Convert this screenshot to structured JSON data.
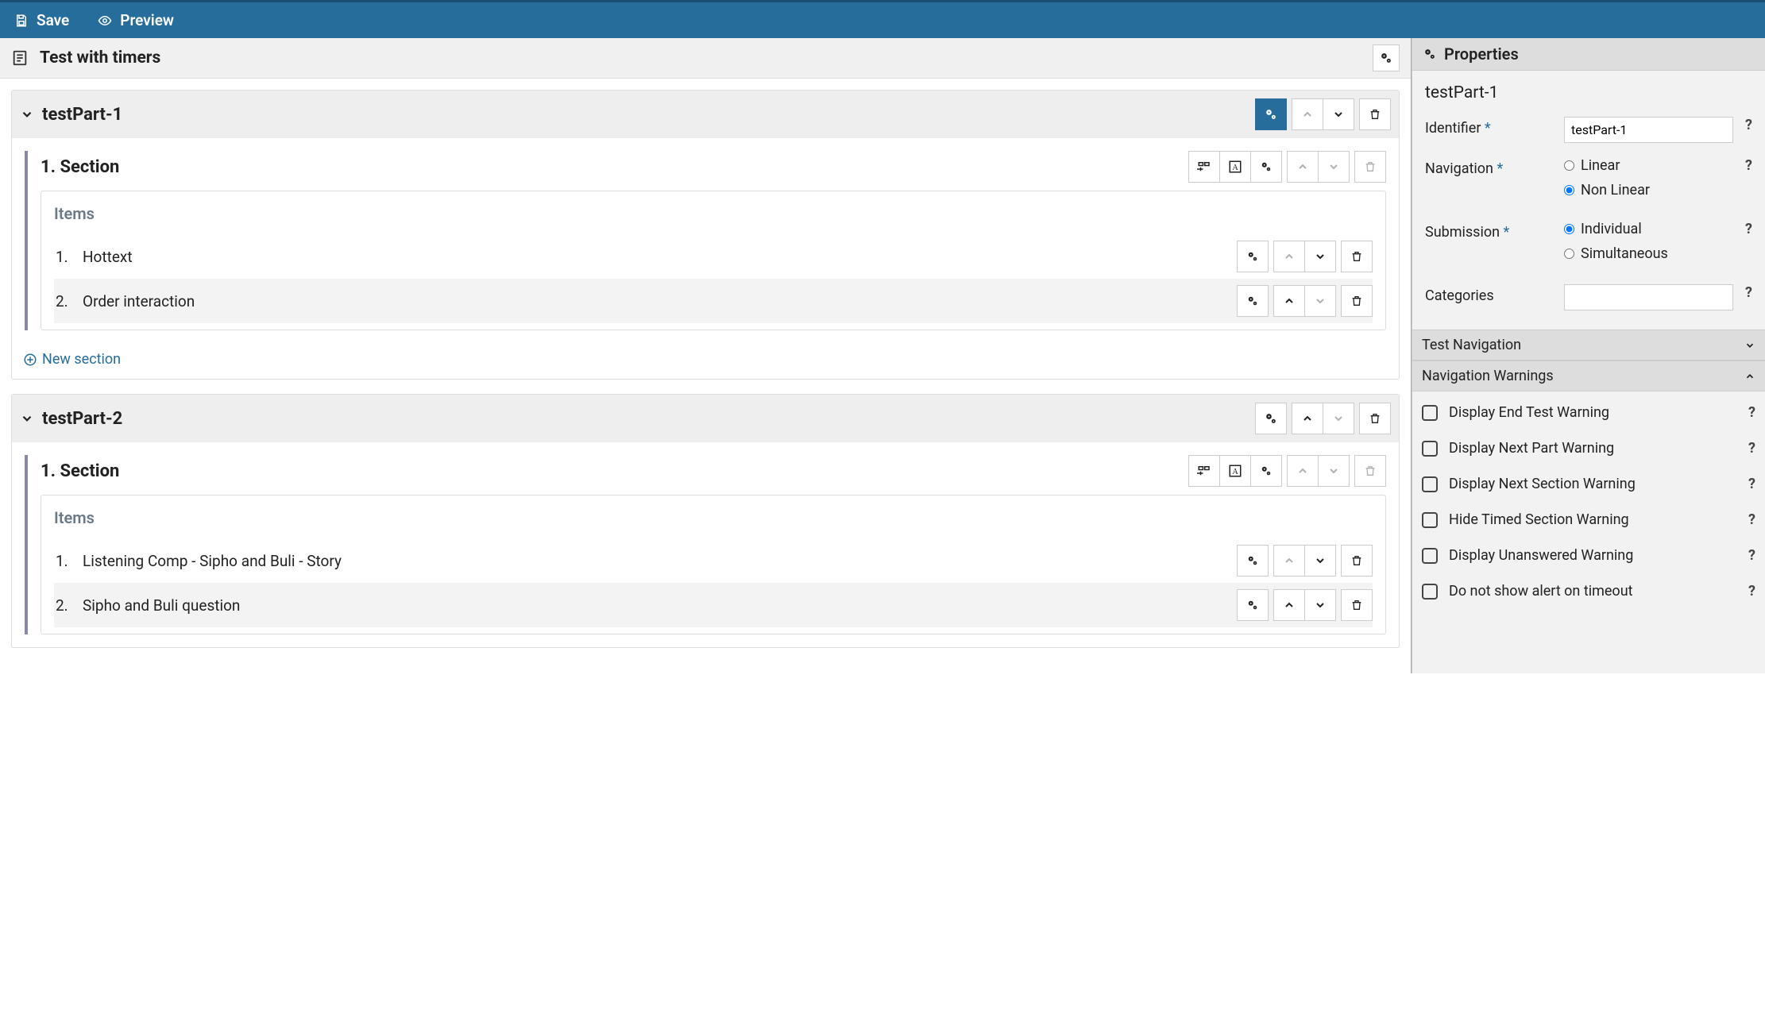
{
  "topbar": {
    "save_label": "Save",
    "preview_label": "Preview"
  },
  "test_title": "Test with timers",
  "parts": [
    {
      "id": "testPart-1",
      "title": "testPart-1",
      "active": true,
      "sections": [
        {
          "label": "1. Section",
          "items_label": "Items",
          "items": [
            {
              "num": "1.",
              "label": "Hottext",
              "up_disabled": true,
              "down_disabled": false
            },
            {
              "num": "2.",
              "label": "Order interaction",
              "up_disabled": false,
              "down_disabled": true
            }
          ]
        }
      ],
      "new_section_label": "New section"
    },
    {
      "id": "testPart-2",
      "title": "testPart-2",
      "active": false,
      "sections": [
        {
          "label": "1. Section",
          "items_label": "Items",
          "items": [
            {
              "num": "1.",
              "label": "Listening Comp - Sipho and Buli - Story",
              "up_disabled": true,
              "down_disabled": false
            },
            {
              "num": "2.",
              "label": "Sipho and Buli question",
              "up_disabled": false,
              "down_disabled": false
            }
          ]
        }
      ]
    }
  ],
  "panel": {
    "title": "Properties",
    "object_title": "testPart-1",
    "identifier_label": "Identifier",
    "identifier_value": "testPart-1",
    "navigation_label": "Navigation",
    "nav_options": {
      "linear": "Linear",
      "nonlinear": "Non Linear"
    },
    "nav_selected": "nonlinear",
    "submission_label": "Submission",
    "sub_options": {
      "individual": "Individual",
      "simultaneous": "Simultaneous"
    },
    "sub_selected": "individual",
    "categories_label": "Categories",
    "categories_value": "",
    "section_testnav": "Test Navigation",
    "section_navwarn": "Navigation Warnings",
    "warnings": [
      "Display End Test Warning",
      "Display Next Part Warning",
      "Display Next Section Warning",
      "Hide Timed Section Warning",
      "Display Unanswered Warning",
      "Do not show alert on timeout"
    ]
  }
}
